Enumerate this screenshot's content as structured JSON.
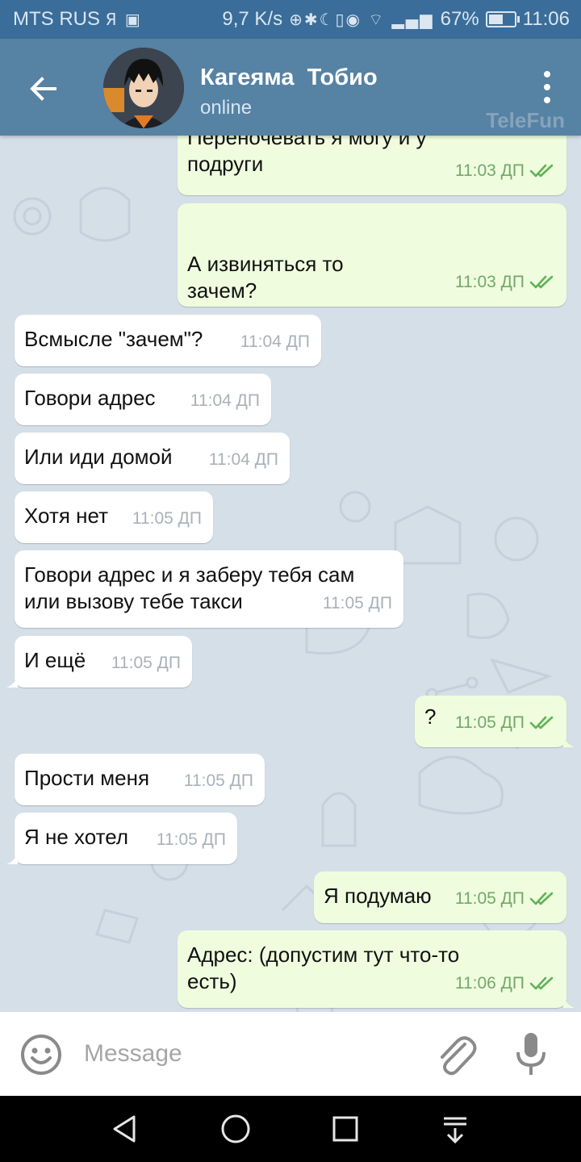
{
  "status_bar": {
    "carrier": "MTS RUS",
    "speed": "9,7 K/s",
    "battery": "67%",
    "battery_level": 0.67,
    "time": "11:06"
  },
  "header": {
    "contact_name": "Кагеяма  Тобио",
    "status": "online",
    "watermark": "TeleFun"
  },
  "colors": {
    "header": "#5682a3",
    "status_bar": "#3a6d99",
    "incoming_bubble": "#ffffff",
    "outgoing_bubble": "#effdde",
    "read_ticks": "#5fb357"
  },
  "messages": [
    {
      "dir": "out",
      "text": "Переночевать я могу и у\nподруги",
      "time": "11:03 ДП",
      "read": true
    },
    {
      "dir": "out",
      "text": "\nА извиняться то\nзачем?",
      "time": "11:03 ДП",
      "read": true
    },
    {
      "dir": "in",
      "text": "Всмысле \"зачем\"?",
      "time": "11:04 ДП"
    },
    {
      "dir": "in",
      "text": "Говори адрес",
      "time": "11:04 ДП"
    },
    {
      "dir": "in",
      "text": "Или иди домой",
      "time": "11:04 ДП"
    },
    {
      "dir": "in",
      "text": "Хотя нет",
      "time": "11:05 ДП"
    },
    {
      "dir": "in",
      "text": "Говори адрес и я заберу тебя сам\nили вызову тебе такси",
      "time": "11:05 ДП"
    },
    {
      "dir": "in",
      "text": "И ещё",
      "time": "11:05 ДП"
    },
    {
      "dir": "out",
      "text": "?",
      "time": "11:05 ДП",
      "read": true
    },
    {
      "dir": "in",
      "text": "Прости меня",
      "time": "11:05 ДП"
    },
    {
      "dir": "in",
      "text": "Я не хотел",
      "time": "11:05 ДП"
    },
    {
      "dir": "out",
      "text": "Я подумаю",
      "time": "11:05 ДП",
      "read": true
    },
    {
      "dir": "out",
      "text": "Адрес: (допустим тут что-то\nесть)",
      "time": "11:06 ДП",
      "read": true
    }
  ],
  "input": {
    "placeholder": "Message",
    "value": ""
  },
  "icons": {
    "back": "arrow-left-icon",
    "menu": "more-vertical-icon",
    "emoji": "smiley-icon",
    "attach": "paperclip-icon",
    "mic": "microphone-icon",
    "nav_back": "triangle-back-icon",
    "nav_home": "circle-home-icon",
    "nav_recent": "square-recent-icon",
    "nav_notifications": "pull-down-icon"
  }
}
